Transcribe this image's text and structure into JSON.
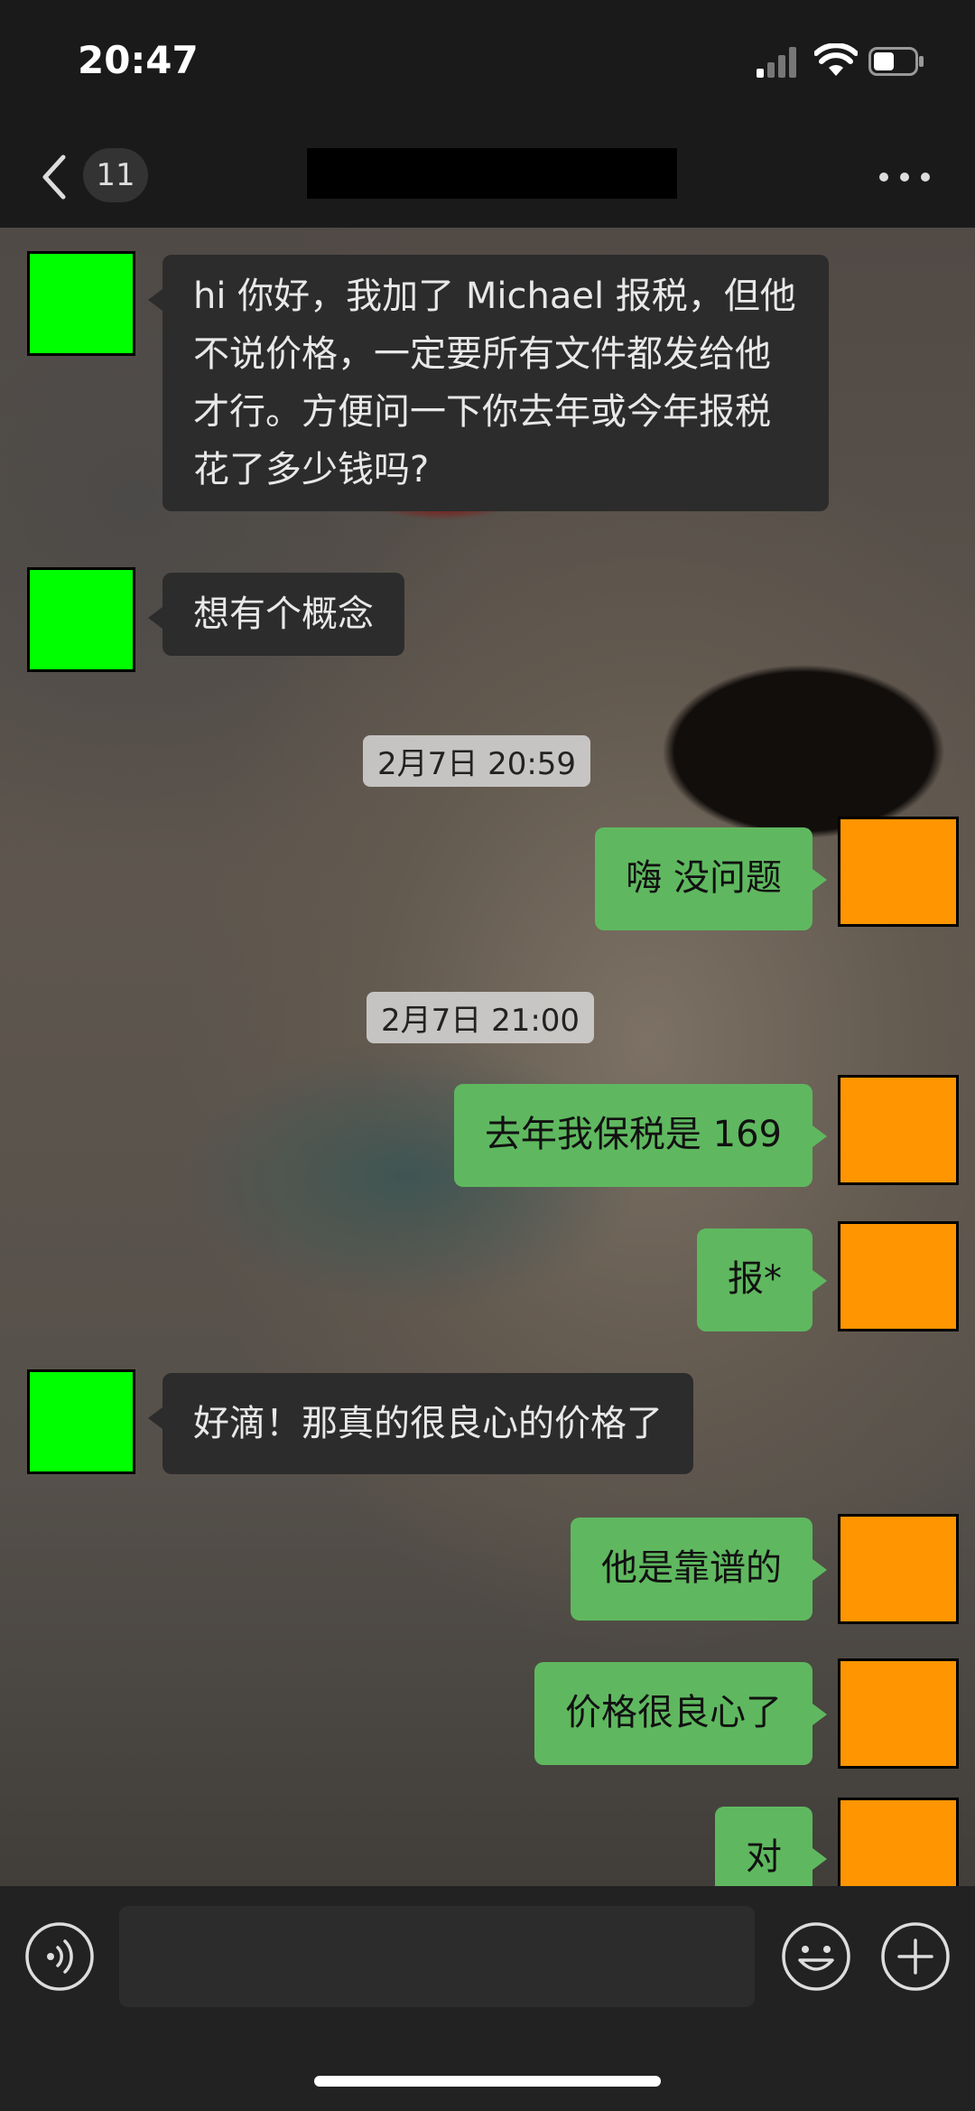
{
  "status_bar": {
    "time": "20:47"
  },
  "nav": {
    "unread_count": "11"
  },
  "messages": [
    {
      "text": "hi 你好，我加了 Michael 报税，但他不说价格，一定要所有文件都发给他才行。方便问一下你去年或今年报税花了多少钱吗?"
    },
    {
      "text": "想有个概念"
    },
    {
      "timestamp": "2月7日 20:59"
    },
    {
      "text": "嗨 没问题"
    },
    {
      "timestamp": "2月7日 21:00"
    },
    {
      "text": "去年我保税是 169"
    },
    {
      "text": "报*"
    },
    {
      "text": "好滴！那真的很良心的价格了"
    },
    {
      "text": "他是靠谱的"
    },
    {
      "text": "价格很良心了"
    },
    {
      "text": "对"
    }
  ],
  "colors": {
    "incoming_bubble": "#2c2c2c",
    "outgoing_bubble": "#5fb85f",
    "incoming_avatar": "#00ff00",
    "outgoing_avatar": "#ff9500"
  },
  "icons": {
    "back": "chevron-left-icon",
    "more": "more-dots-icon",
    "voice": "voice-icon",
    "emoji": "emoji-icon",
    "add": "plus-icon"
  }
}
